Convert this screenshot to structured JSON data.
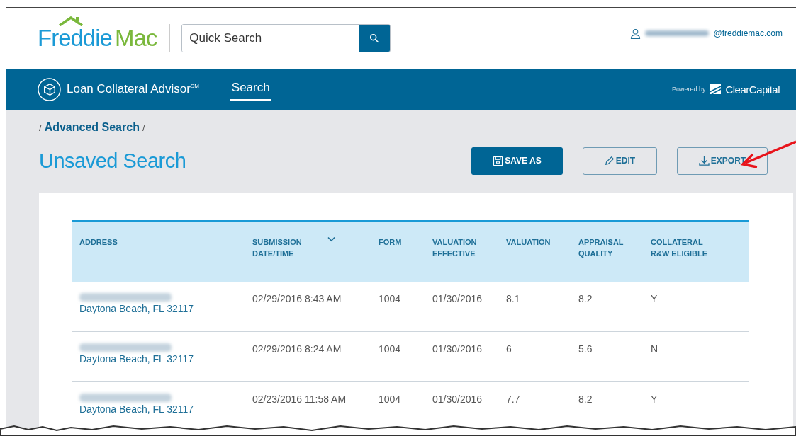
{
  "header": {
    "logo": {
      "first": "Freddie",
      "second": "Mac"
    },
    "quick_search": {
      "placeholder": "Quick Search"
    },
    "user": {
      "email_visible": "@freddiemac.com"
    }
  },
  "nav": {
    "product": "Loan Collateral Advisor$^{SM}$",
    "tabs": [
      {
        "label": "Search",
        "selected": true
      }
    ],
    "powered_by": "Powered by",
    "partner": "ClearCapital"
  },
  "breadcrumb": [
    {
      "kind": "sep",
      "text": "/"
    },
    {
      "kind": "link",
      "text": "Advanced Search"
    },
    {
      "kind": "sep",
      "text": "/"
    }
  ],
  "page_title": "Unsaved Search",
  "actions": [
    {
      "kind": "primary",
      "label": "SAVE AS"
    },
    {
      "kind": "outline",
      "label": "EDIT"
    },
    {
      "kind": "outline",
      "label": "EXPORT"
    }
  ],
  "table": {
    "columns": [
      {
        "label": "ADDRESS",
        "sorted": false
      },
      {
        "label": "SUBMISSION DATE/TIME",
        "sorted": true
      },
      {
        "label": "FORM",
        "sorted": false
      },
      {
        "label": "VALUATION EFFECTIVE",
        "sorted": false
      },
      {
        "label": "VALUATION",
        "sorted": false
      },
      {
        "label": "APPRAISAL QUALITY",
        "sorted": false
      },
      {
        "label": "COLLATERAL R&W ELIGIBLE",
        "sorted": false
      }
    ],
    "rows": [
      {
        "cells": [
          "Daytona Beach, FL 32117",
          "02/29/2016 8:43 AM",
          "1004",
          "01/30/2016",
          "8.1",
          "8.2",
          "Y"
        ]
      },
      {
        "cells": [
          "Daytona Beach, FL 32117",
          "02/29/2016 8:24 AM",
          "1004",
          "01/30/2016",
          "6",
          "5.6",
          "N"
        ]
      },
      {
        "cells": [
          "Daytona Beach, FL 32117",
          "02/23/2016 11:58 AM",
          "1004",
          "01/30/2016",
          "7.7",
          "8.2",
          "Y"
        ]
      }
    ]
  }
}
